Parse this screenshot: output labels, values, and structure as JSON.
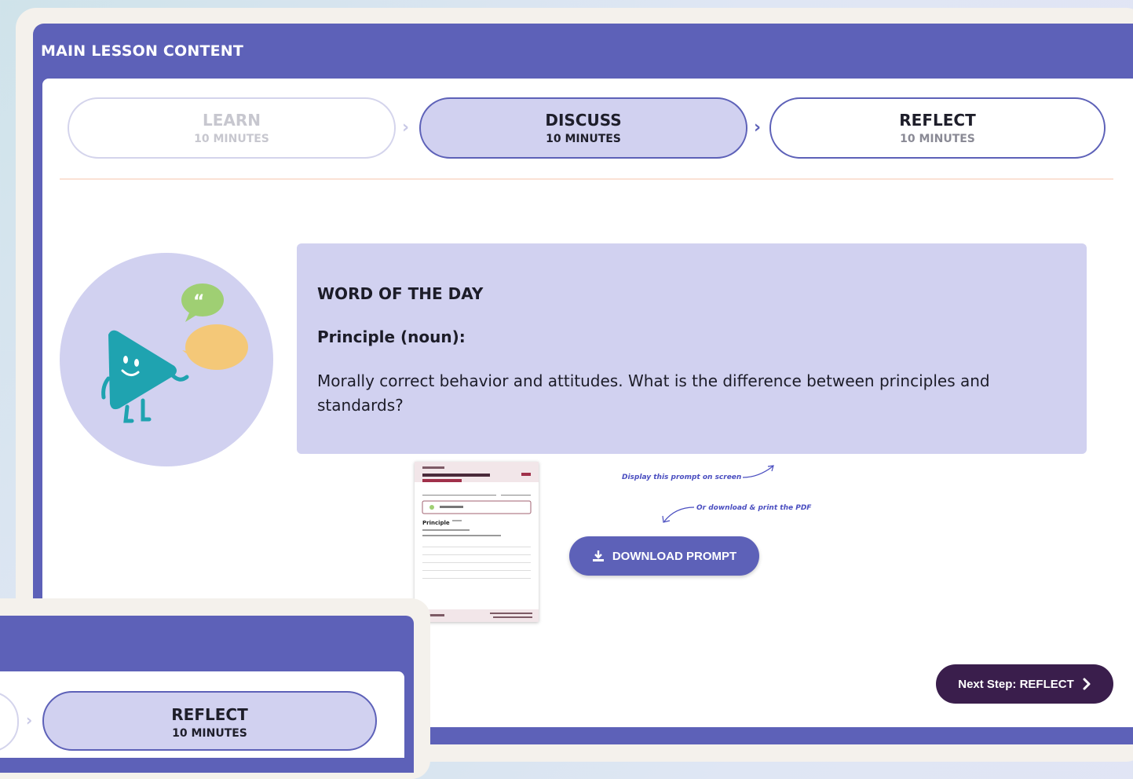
{
  "panel": {
    "title": "MAIN LESSON CONTENT"
  },
  "steps": [
    {
      "name": "LEARN",
      "duration": "10 MINUTES",
      "state": "completed"
    },
    {
      "name": "DISCUSS",
      "duration": "10 MINUTES",
      "state": "active"
    },
    {
      "name": "REFLECT",
      "duration": "10 MINUTES",
      "state": "upcoming"
    }
  ],
  "word_of_day": {
    "heading": "WORD OF THE DAY",
    "word": "Principle (noun):",
    "definition": "Morally correct behavior and attitudes. What is the difference between principles and standards?"
  },
  "pdf_preview": {
    "word_label": "Principle"
  },
  "hints": {
    "display": "Display this prompt on screen",
    "download": "Or download & print the PDF"
  },
  "buttons": {
    "download": "DOWNLOAD PROMPT",
    "next": "Next Step: REFLECT"
  },
  "second_window": {
    "step": {
      "name": "REFLECT",
      "duration": "10 MINUTES"
    }
  },
  "colors": {
    "brand_purple": "#5d61b8",
    "light_purple": "#d1d1f0",
    "dark_plum": "#3a1e4c",
    "cream": "#f4f1ec",
    "teal": "#1fa3b0",
    "bubble_green": "#9fcf73",
    "bubble_yellow": "#f4c878"
  },
  "icons": {
    "download": "download-icon",
    "next": "chevron-right-icon",
    "step_separator": "chevron-right-icon"
  }
}
